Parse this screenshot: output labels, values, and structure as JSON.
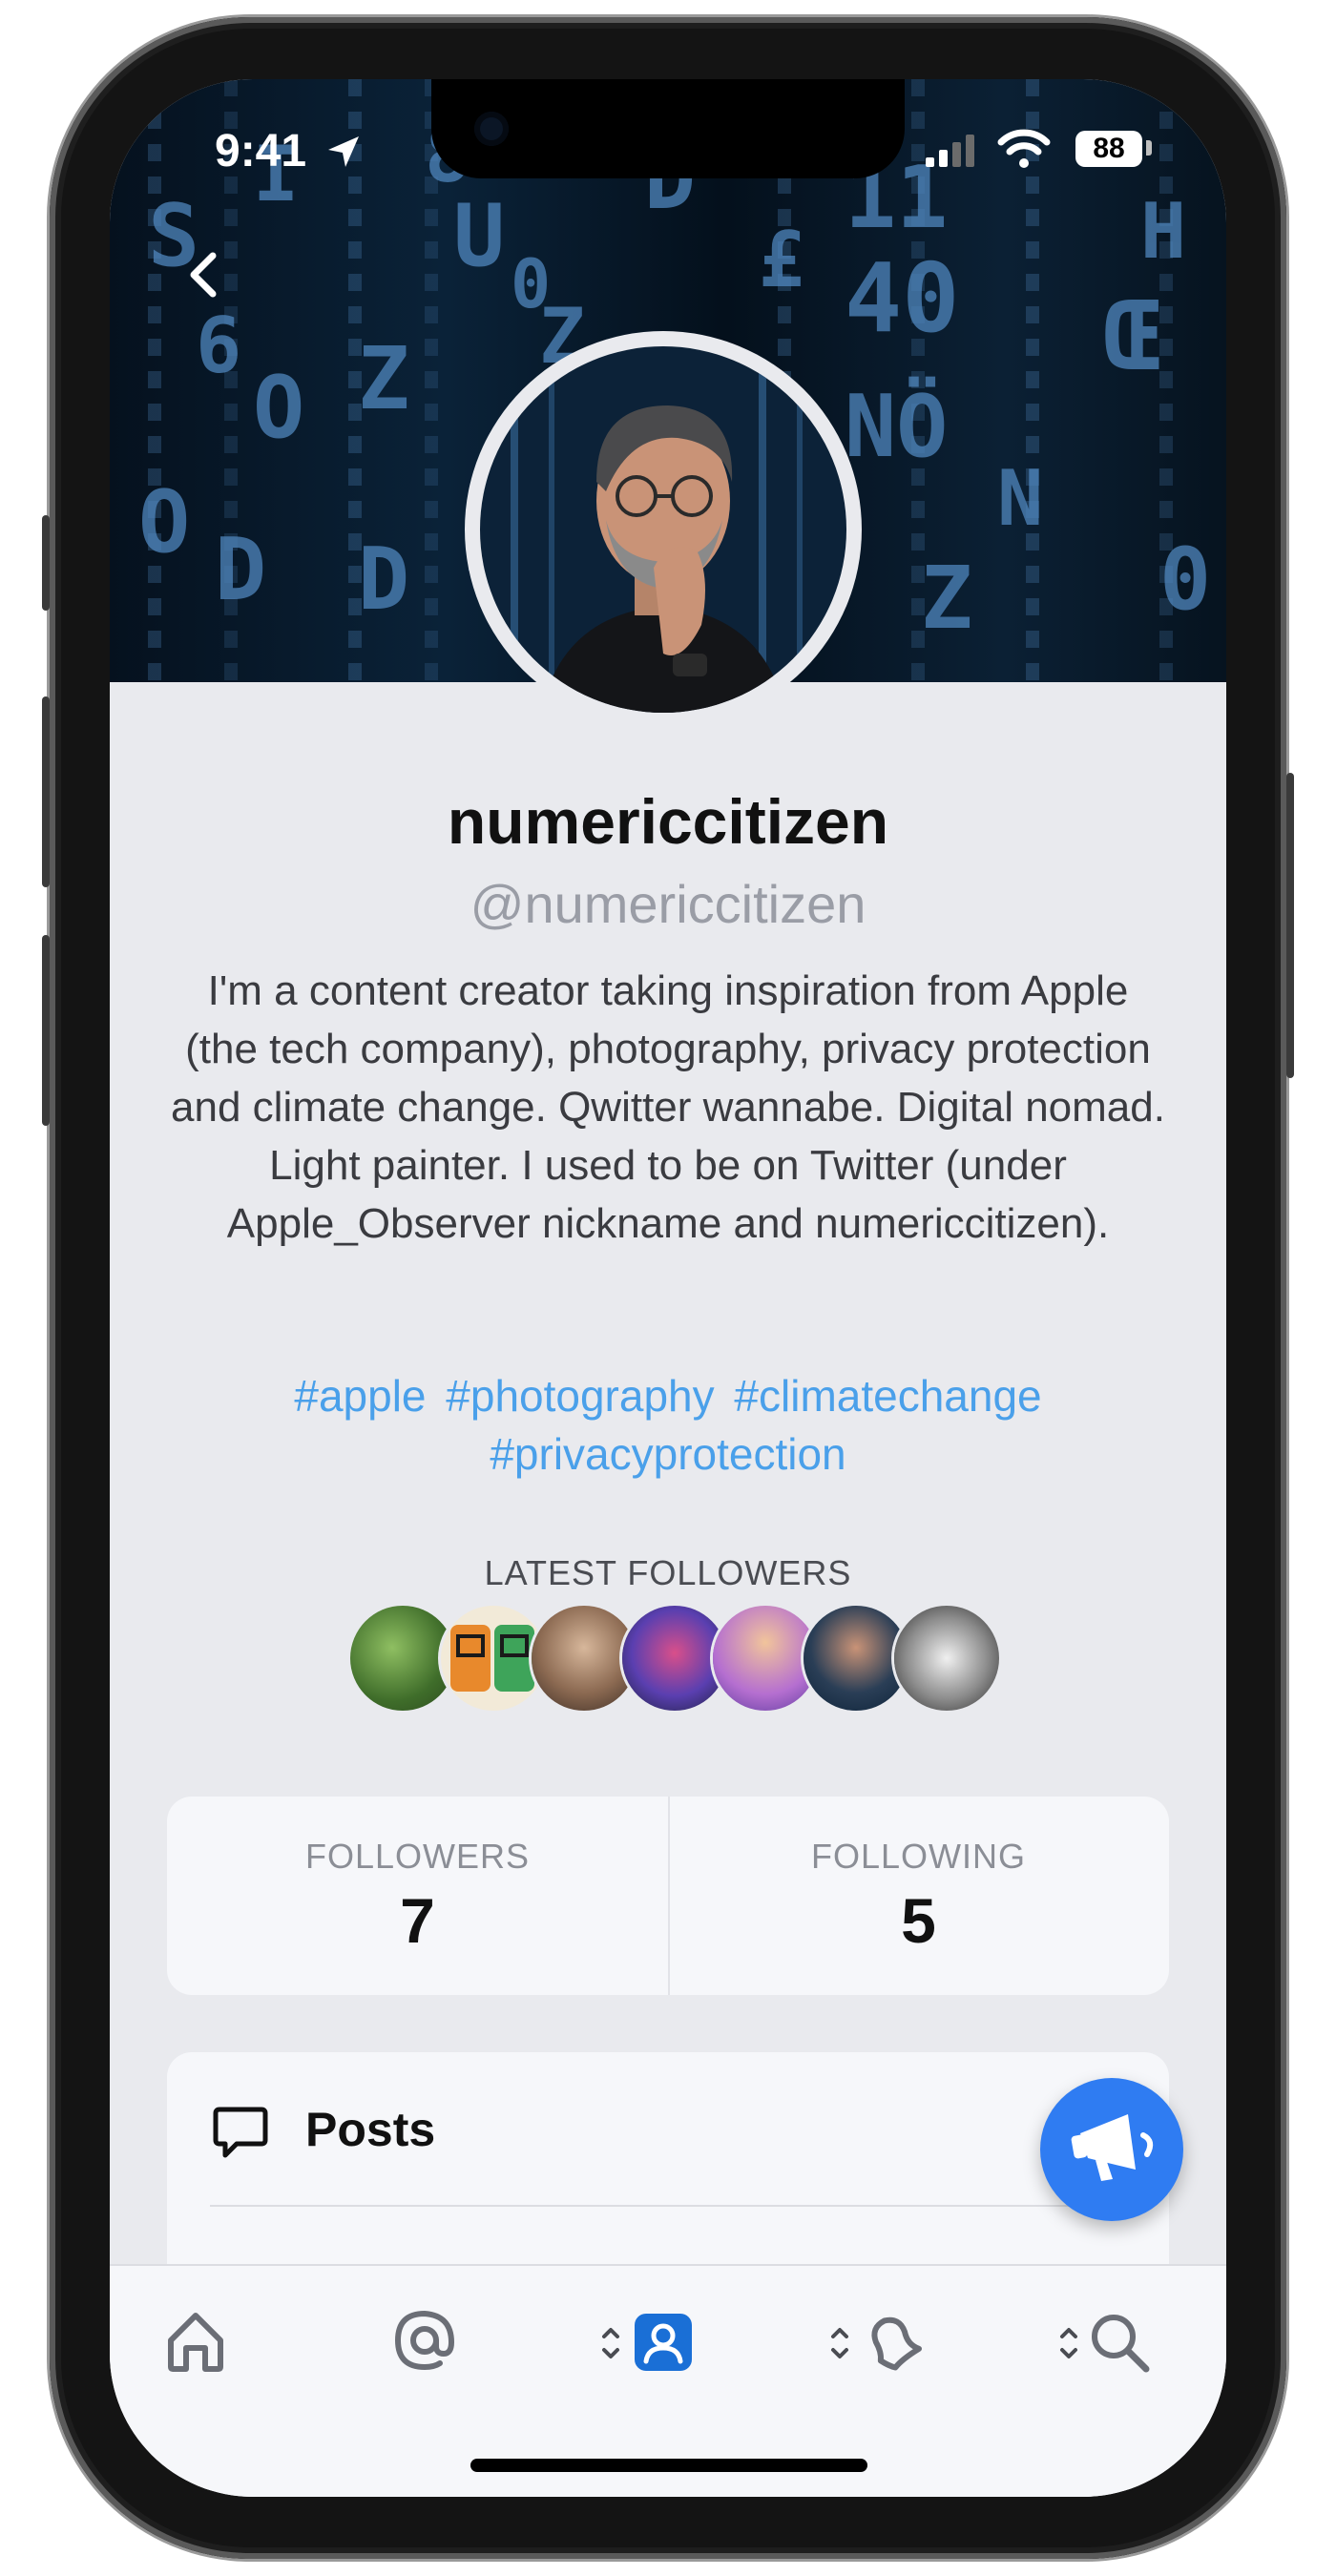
{
  "status_bar": {
    "time": "9:41",
    "battery": "88"
  },
  "profile": {
    "display_name": "numericcitizen",
    "handle": "@numericcitizen",
    "bio": "I'm a content creator taking inspiration from Apple (the tech company), photography, privacy protection and climate change. Qwitter wannabe. Digital nomad. Light painter. I used to be on Twitter (under Apple_Observer nickname and numericcitizen).",
    "hashtags": [
      "#apple",
      "#photography",
      "#climatechange",
      "#privacyprotection"
    ]
  },
  "latest_followers": {
    "title": "LATEST FOLLOWERS"
  },
  "stats": {
    "followers_label": "FOLLOWERS",
    "followers_count": "7",
    "following_label": "FOLLOWING",
    "following_count": "5"
  },
  "menu": {
    "posts_label": "Posts"
  },
  "banner": {
    "glyphs": [
      "S",
      "6",
      "O",
      "I",
      "O",
      "D",
      "Z",
      "U",
      "D",
      "8",
      "D",
      "Z",
      "0",
      "D",
      "£",
      "11",
      "40",
      "NÖ",
      "Œ",
      "H",
      "N",
      "Z",
      "0"
    ]
  },
  "colors": {
    "accent": "#2f7cf2",
    "hashtag": "#4aa0ea",
    "background": "#e9eaee",
    "card": "#f6f7fa"
  },
  "icons": {
    "back": "chevron-left-icon",
    "posts": "speech-bubble-icon",
    "fab": "megaphone-icon",
    "tabs": [
      "home-icon",
      "at-sign-icon",
      "profile-icon",
      "bell-icon",
      "search-icon"
    ]
  }
}
